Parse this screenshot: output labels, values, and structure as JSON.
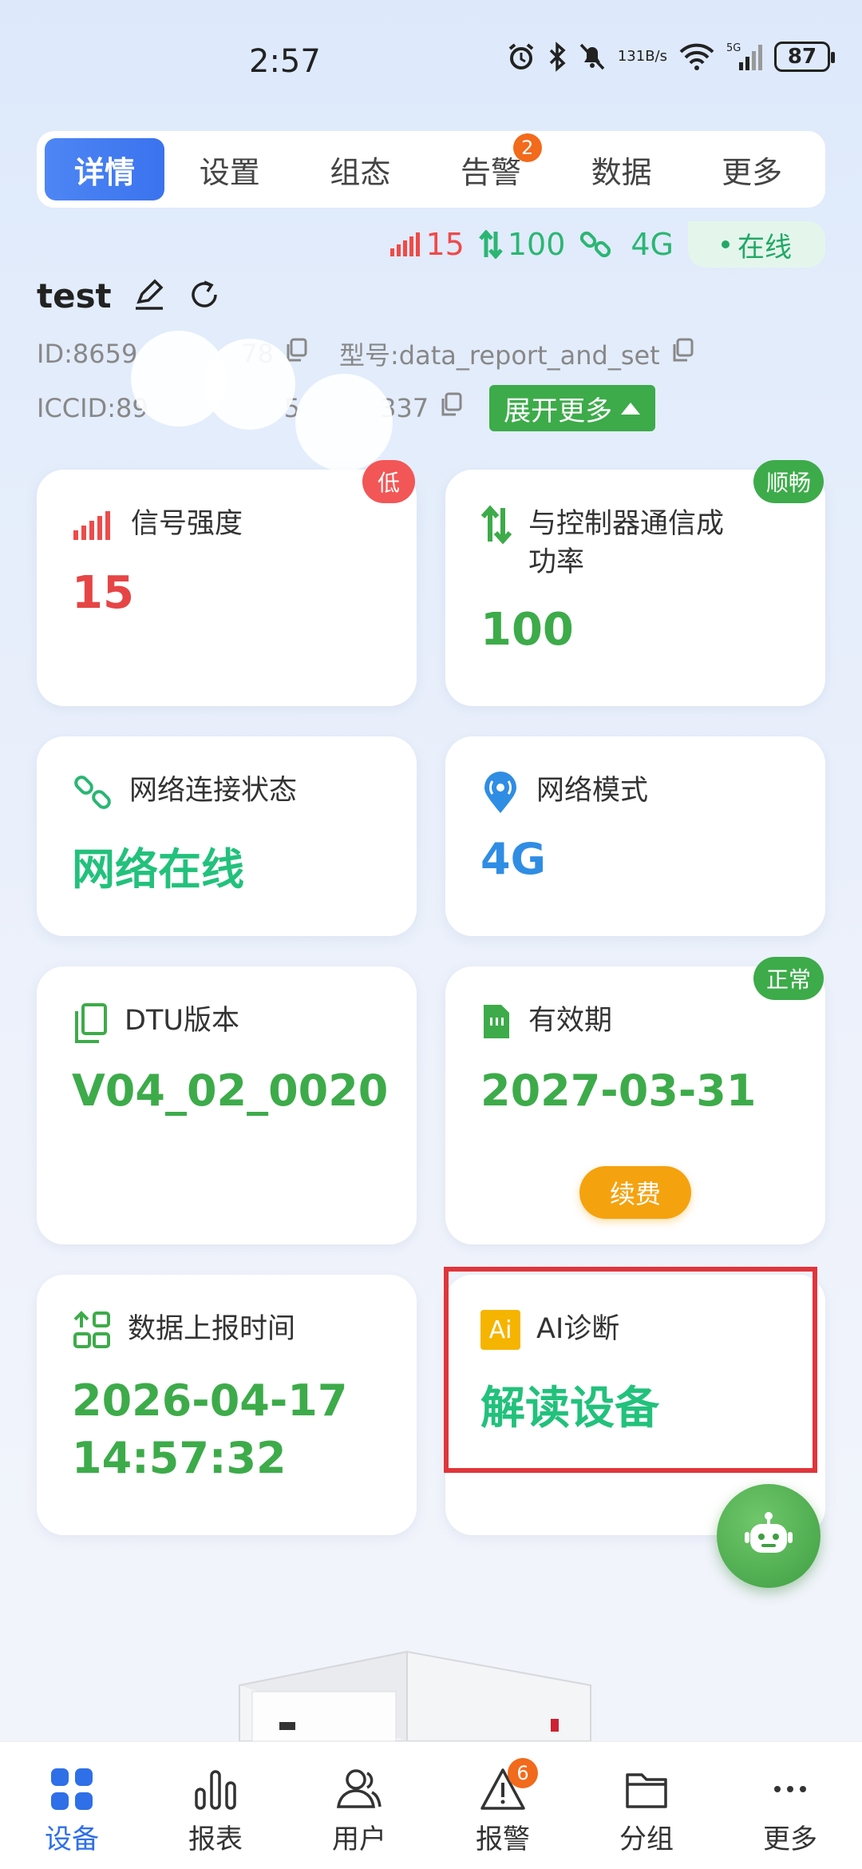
{
  "status_bar": {
    "time": "2:57",
    "net_speed_value": "131",
    "net_speed_unit": "B/s",
    "network_type": "5G",
    "battery": "87"
  },
  "tabs": [
    {
      "label": "详情",
      "active": true
    },
    {
      "label": "设置"
    },
    {
      "label": "组态"
    },
    {
      "label": "告警",
      "badge": "2"
    },
    {
      "label": "数据"
    },
    {
      "label": "更多"
    }
  ],
  "indicators": {
    "signal": "15",
    "success_rate": "100",
    "mode": "4G",
    "online": "在线"
  },
  "device": {
    "name": "test",
    "id_prefix": "ID:8659",
    "id_suffix": "78",
    "model": "型号:data_report_and_set",
    "iccid_prefix": "ICCID:89",
    "iccid_mid": "5",
    "iccid_suffix": "337",
    "expand_label": "展开更多"
  },
  "cards": {
    "signal": {
      "label": "信号强度",
      "value": "15",
      "tag": "低"
    },
    "comm": {
      "label_line1": "与控制器通信成",
      "label_line2": "功率",
      "value": "100",
      "tag": "顺畅"
    },
    "network_state": {
      "label": "网络连接状态",
      "value": "网络在线"
    },
    "network_mode": {
      "label": "网络模式",
      "value": "4G"
    },
    "dtu": {
      "label": "DTU版本",
      "value": "V04_02_0020"
    },
    "validity": {
      "label": "有效期",
      "value": "2027-03-31",
      "tag": "正常",
      "renew": "续费"
    },
    "report_time": {
      "label": "数据上报时间",
      "value_date": "2026-04-17",
      "value_time": "14:57:32"
    },
    "ai": {
      "icon_text": "Ai",
      "label": "AI诊断",
      "value": "解读设备"
    }
  },
  "bottom_nav": [
    {
      "label": "设备",
      "icon": "grid-icon",
      "active": true
    },
    {
      "label": "报表",
      "icon": "bar-chart-icon"
    },
    {
      "label": "用户",
      "icon": "users-icon"
    },
    {
      "label": "报警",
      "icon": "warning-icon",
      "badge": "6"
    },
    {
      "label": "分组",
      "icon": "folder-icon"
    },
    {
      "label": "更多",
      "icon": "more-icon"
    }
  ],
  "colors": {
    "primary_blue": "#3a73ee",
    "green": "#3dab4a",
    "red": "#ef4a4a",
    "orange": "#f5a20f",
    "badge_orange": "#f26a1b"
  }
}
